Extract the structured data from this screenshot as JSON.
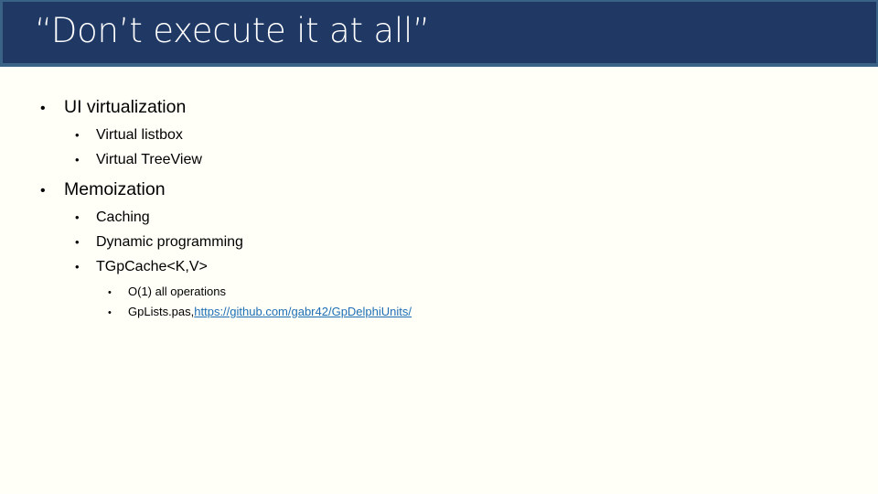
{
  "slide": {
    "title": "“Don’t execute it at all”",
    "bullet_glyph": "•",
    "colors": {
      "title_bar": "#1F3864",
      "title_bar_border": "#3A6186",
      "title_text": "#FFFFFF",
      "background": "#FFFFF8",
      "body_text": "#000000",
      "hyperlink": "#1F6FB5"
    },
    "content": [
      {
        "level": 1,
        "text": "UI virtualization"
      },
      {
        "level": 2,
        "text": "Virtual listbox"
      },
      {
        "level": 2,
        "text": "Virtual TreeView"
      },
      {
        "level": 1,
        "text": "Memoization"
      },
      {
        "level": 2,
        "text": "Caching"
      },
      {
        "level": 2,
        "text": "Dynamic programming"
      },
      {
        "level": 2,
        "text": "TGpCache<K,V>"
      },
      {
        "level": 3,
        "text": "O(1) all operations"
      },
      {
        "level": 3,
        "text": "GpLists.pas, ",
        "link_text": "https://github.com/gabr42/GpDelphiUnits/"
      }
    ]
  }
}
